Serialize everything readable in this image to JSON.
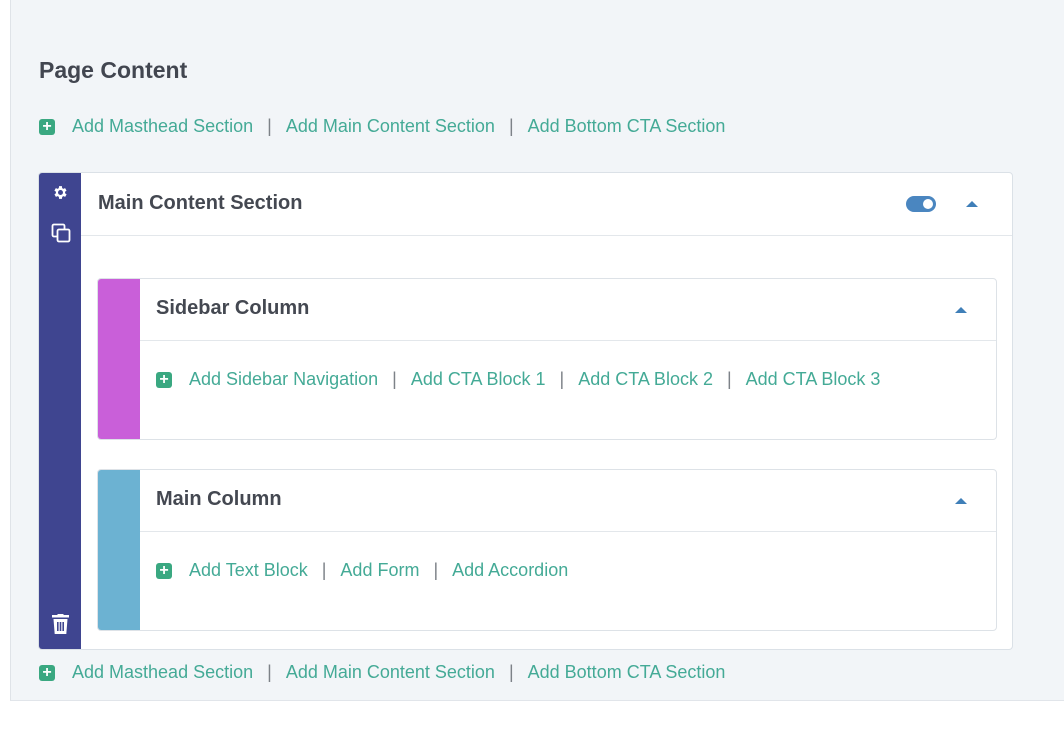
{
  "page": {
    "title": "Page Content"
  },
  "top_add_links": [
    "Add Masthead Section",
    "Add Main Content Section",
    "Add Bottom CTA Section"
  ],
  "bottom_add_links": [
    "Add Masthead Section",
    "Add Main Content Section",
    "Add Bottom CTA Section"
  ],
  "section": {
    "title": "Main Content Section",
    "toggle_on": true,
    "rail_color": "#3f4590",
    "columns": [
      {
        "title": "Sidebar Column",
        "stripe_color": "#c95fd9",
        "add_links": [
          "Add Sidebar Navigation",
          "Add CTA Block 1",
          "Add CTA Block 2",
          "Add CTA Block 3"
        ]
      },
      {
        "title": "Main Column",
        "stripe_color": "#6cb2d2",
        "add_links": [
          "Add Text Block",
          "Add Form",
          "Add Accordion"
        ]
      }
    ]
  },
  "icons": {
    "add": "plus-square-icon",
    "settings": "gear-icon",
    "duplicate": "copy-icon",
    "delete": "trash-icon",
    "collapse": "caret-up-icon",
    "toggle": "toggle-switch-icon"
  },
  "colors": {
    "link": "#44aa96",
    "plus_icon": "#3aa881",
    "toggle": "#4a86c0",
    "caret": "#3f7fb8",
    "panel_bg": "#f2f5f8"
  }
}
